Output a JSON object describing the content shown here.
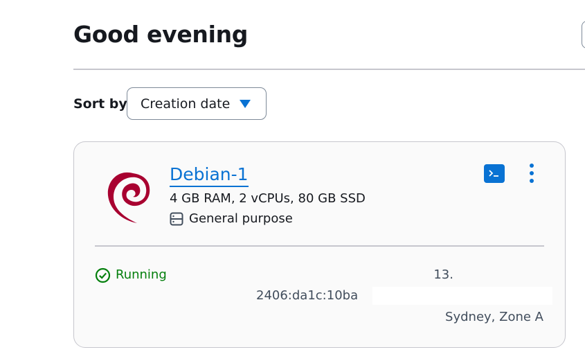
{
  "header": {
    "greeting": "Good evening"
  },
  "sort": {
    "label": "Sort by",
    "selected": "Creation date"
  },
  "instance": {
    "name": "Debian-1",
    "specs": "4 GB RAM, 2 vCPUs, 80 GB SSD",
    "purpose": "General purpose",
    "status": "Running",
    "ipv4": "13.",
    "ipv6": "2406:da1c:10ba",
    "location": "Sydney, Zone A",
    "logo_icon": "debian-swirl-icon",
    "purpose_icon": "server-icon",
    "status_icon": "check-circle-icon"
  },
  "colors": {
    "link": "#0972d3",
    "status_running": "#037f0c",
    "debian": "#a80030"
  }
}
